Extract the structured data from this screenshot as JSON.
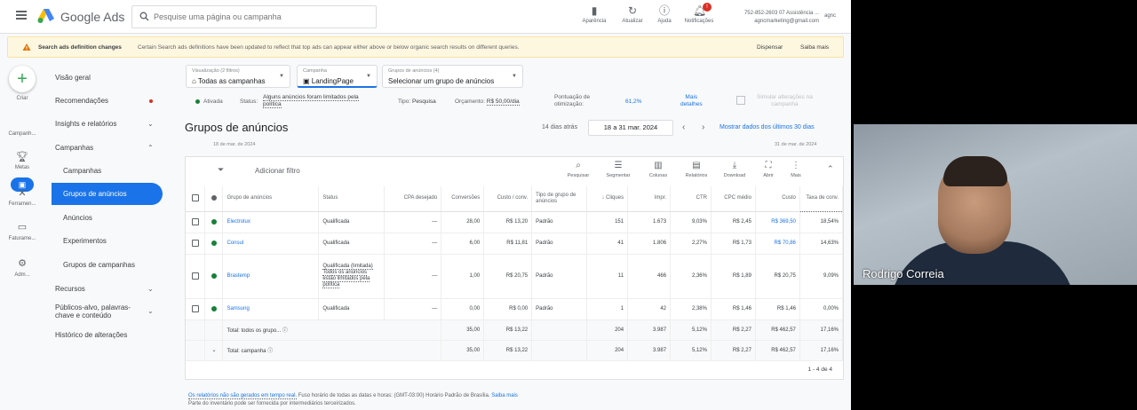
{
  "header": {
    "product": "Google Ads",
    "search_placeholder": "Pesquise uma página ou campanha",
    "tools": [
      {
        "label": "Aparência",
        "icon": "appearance-icon"
      },
      {
        "label": "Atualizar",
        "icon": "refresh-icon"
      },
      {
        "label": "Ajuda",
        "icon": "help-icon"
      },
      {
        "label": "Notificações",
        "icon": "bell-icon",
        "badge": "!"
      }
    ],
    "account_line1": "752-852-2603 07 Assistência ...",
    "account_line2": "agncmarketing@gmail.com",
    "account_short": "agnc"
  },
  "banner": {
    "title": "Search ads definition changes",
    "text": "Certain Search ads definitions have been updated to reflect that top ads can appear either above or below organic search results on different queries.",
    "dismiss": "Dispensar",
    "learn": "Saiba mais"
  },
  "rail": {
    "create": "Criar",
    "campaigns": "Campanh...",
    "goals": "Metas",
    "tools": "Ferramen...",
    "billing": "Faturame...",
    "admin": "Adm..."
  },
  "nav": {
    "overview": "Visão geral",
    "recommendations": "Recomendações",
    "insights": "Insights e relatórios",
    "campaigns": "Campanhas",
    "sub_campaigns": "Campanhas",
    "sub_adgroups": "Grupos de anúncios",
    "sub_ads": "Anúncios",
    "sub_experiments": "Experimentos",
    "sub_campaign_groups": "Grupos de campanhas",
    "assets": "Recursos",
    "audiences_l1": "Públicos-alvo, palavras-",
    "audiences_l2": "chave e conteúdo",
    "history": "Histórico de alterações"
  },
  "selectors": {
    "view_label": "Visualização (2 filtros)",
    "view_value": "Todas as campanhas",
    "campaign_label": "Campanha",
    "campaign_value": "LandingPage",
    "adgroup_label": "Grupos de anúncios (4)",
    "adgroup_value": "Selecionar um grupo de anúncios"
  },
  "status_bar": {
    "state": "Ativada",
    "status_label": "Status:",
    "status_l1": "Alguns anúncios foram limitados pela",
    "status_l2": "política",
    "type_label": "Tipo:",
    "type_value": "Pesquisa",
    "budget_label": "Orçamento:",
    "budget_value": "R$ 50,00/dia",
    "score_l1": "Pontuação de",
    "score_l2": "otimização:",
    "score_value": "61,2%",
    "more_l1": "Mais",
    "more_l2": "detalhes",
    "simulate_l1": "Simular alterações na",
    "simulate_l2": "campanha"
  },
  "page": {
    "title": "Grupos de anúncios",
    "range_label": "14 dias atrás",
    "range_value": "18 a 31 mar. 2024",
    "show_30": "Mostrar dados dos últimos 30 dias",
    "date_start": "18 de mar. de 2024",
    "date_end": "31 de mar. de 2024"
  },
  "toolbar": {
    "filter": "Adicionar filtro",
    "items": [
      {
        "label": "Pesquisar",
        "icon": "search-icon"
      },
      {
        "label": "Segmentar",
        "icon": "segment-icon"
      },
      {
        "label": "Colunas",
        "icon": "columns-icon"
      },
      {
        "label": "Relatórios",
        "icon": "reports-icon"
      },
      {
        "label": "Download",
        "icon": "download-icon"
      },
      {
        "label": "Abrir",
        "icon": "expand-icon"
      },
      {
        "label": "Mais",
        "icon": "more-icon"
      }
    ]
  },
  "table": {
    "headers": [
      "Grupo de anúncios",
      "Status",
      "CPA desejado",
      "Conversões",
      "Custo / conv.",
      "Tipo de grupo de anúncios",
      "Cliques",
      "Impr.",
      "CTR",
      "CPC médio",
      "Custo",
      "Taxa de conv."
    ],
    "rows": [
      {
        "name": "Electrolux",
        "status": "Qualificada",
        "status_note": "",
        "cpa": "—",
        "conv": "28,00",
        "cost_conv": "R$ 13,20",
        "type": "Padrão",
        "clicks": "151",
        "impr": "1.673",
        "ctr": "9,03%",
        "cpc": "R$ 2,45",
        "cost": "R$ 369,50",
        "conv_rate": "18,54%"
      },
      {
        "name": "Consul",
        "status": "Qualificada",
        "status_note": "",
        "cpa": "—",
        "conv": "6,00",
        "cost_conv": "R$ 11,81",
        "type": "Padrão",
        "clicks": "41",
        "impr": "1.806",
        "ctr": "2,27%",
        "cpc": "R$ 1,73",
        "cost": "R$ 70,86",
        "conv_rate": "14,63%"
      },
      {
        "name": "Brastemp",
        "status": "Qualificada (limitada)",
        "status_note": "Todos os anúncios estão limitados pela política",
        "cpa": "—",
        "conv": "1,00",
        "cost_conv": "R$ 20,75",
        "type": "Padrão",
        "clicks": "11",
        "impr": "466",
        "ctr": "2,36%",
        "cpc": "R$ 1,89",
        "cost": "R$ 20,75",
        "conv_rate": "9,09%"
      },
      {
        "name": "Samsung",
        "status": "Qualificada",
        "status_note": "",
        "cpa": "—",
        "conv": "0,00",
        "cost_conv": "R$ 0,00",
        "type": "Padrão",
        "clicks": "1",
        "impr": "42",
        "ctr": "2,38%",
        "cpc": "R$ 1,46",
        "cost": "R$ 1,46",
        "conv_rate": "0,00%"
      }
    ],
    "totals": [
      {
        "label": "Total: todos os grupo...",
        "conv": "35,00",
        "cost_conv": "R$ 13,22",
        "clicks": "204",
        "impr": "3.987",
        "ctr": "5,12%",
        "cpc": "R$ 2,27",
        "cost": "R$ 462,57",
        "conv_rate": "17,16%"
      },
      {
        "label": "Total: campanha",
        "conv": "35,00",
        "cost_conv": "R$ 13,22",
        "clicks": "204",
        "impr": "3.987",
        "ctr": "5,12%",
        "cpc": "R$ 2,27",
        "cost": "R$ 462,57",
        "conv_rate": "17,16%"
      }
    ],
    "pager": "1 - 4 de 4"
  },
  "footer": {
    "l1_link": "Os relatórios não são gerados em tempo real.",
    "l1_text": "Fuso horário de todas as datas e horas: (GMT-03:00) Horário Padrão de Brasília.",
    "l1_learn": "Saiba mais",
    "l2": "Parte do inventário pode ser fornecida por intermediários terceirizados."
  },
  "webcam": {
    "name": "Rodrigo Correia"
  }
}
